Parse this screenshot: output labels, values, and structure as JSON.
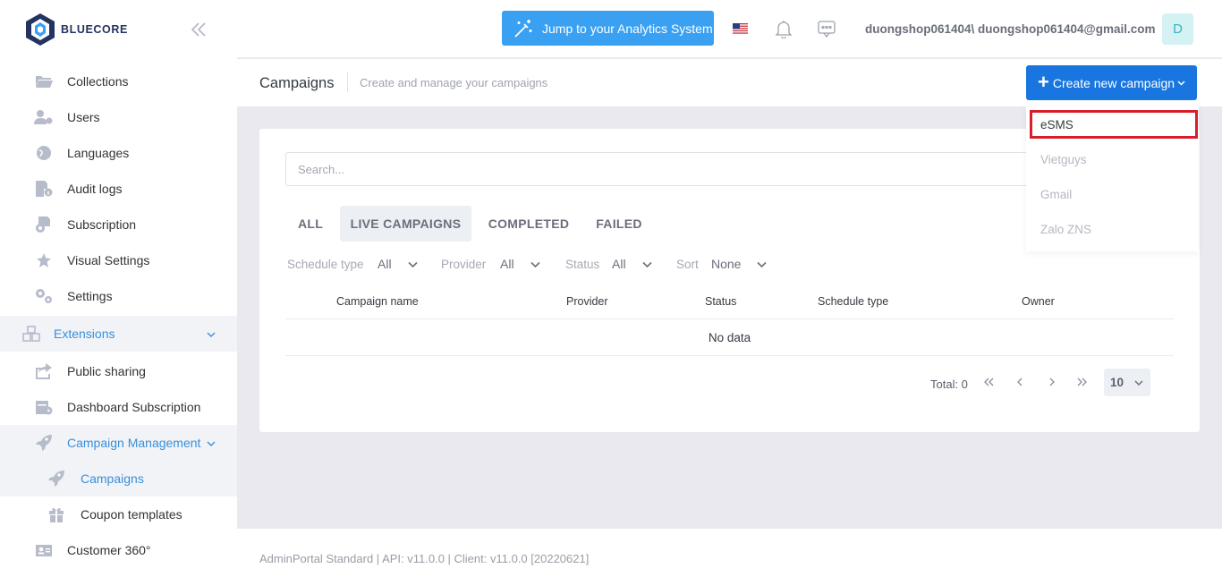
{
  "brand": {
    "name": "BLUECORE"
  },
  "sidebar": {
    "items": [
      {
        "label": "Collections"
      },
      {
        "label": "Users"
      },
      {
        "label": "Languages"
      },
      {
        "label": "Audit logs"
      },
      {
        "label": "Subscription"
      },
      {
        "label": "Visual Settings"
      },
      {
        "label": "Settings"
      },
      {
        "label": "Extensions"
      },
      {
        "label": "Public sharing"
      },
      {
        "label": "Dashboard Subscription"
      },
      {
        "label": "Campaign Management"
      },
      {
        "label": "Campaigns"
      },
      {
        "label": "Coupon templates"
      },
      {
        "label": "Customer 360°"
      }
    ]
  },
  "topbar": {
    "analytics_button": "Jump to your Analytics System",
    "user": "duongshop061404\\ duongshop061404@gmail.com",
    "avatar_letter": "D"
  },
  "page": {
    "title": "Campaigns",
    "subtitle": "Create and manage your campaigns",
    "create_button": "Create new campaign"
  },
  "dropdown": {
    "items": [
      "eSMS",
      "Vietguys",
      "Gmail",
      "Zalo ZNS"
    ],
    "selected": "eSMS"
  },
  "search": {
    "placeholder": "Search..."
  },
  "tabs": [
    "ALL",
    "LIVE CAMPAIGNS",
    "COMPLETED",
    "FAILED"
  ],
  "active_tab": "LIVE CAMPAIGNS",
  "filters": [
    {
      "label": "Schedule type",
      "value": "All"
    },
    {
      "label": "Provider",
      "value": "All"
    },
    {
      "label": "Status",
      "value": "All"
    },
    {
      "label": "Sort",
      "value": "None"
    }
  ],
  "table": {
    "columns": [
      "Campaign name",
      "Provider",
      "Status",
      "Schedule type",
      "Owner"
    ],
    "empty_text": "No data"
  },
  "pagination": {
    "total_label": "Total: 0",
    "page_size": "10"
  },
  "footer": {
    "text": "AdminPortal Standard | API: v11.0.0 | Client: v11.0.0 [20220621]"
  },
  "colors": {
    "primary": "#1976e0",
    "accent": "#3aa0f2",
    "link": "#3a8fdb",
    "highlight": "#d81e2a"
  }
}
